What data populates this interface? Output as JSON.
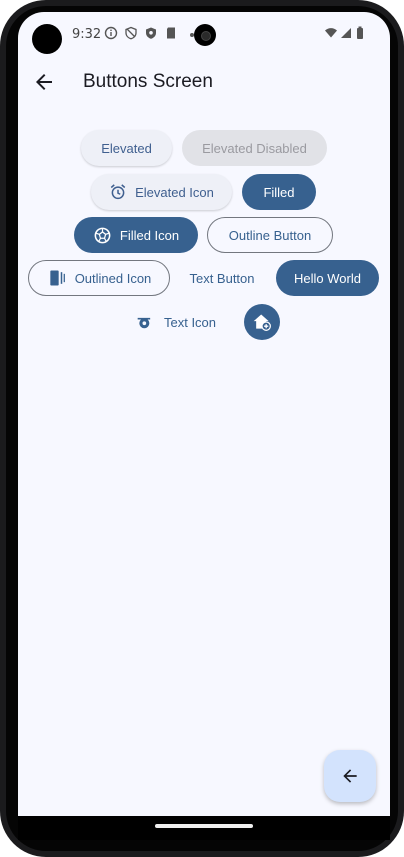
{
  "status_bar": {
    "time": "9:32"
  },
  "app_bar": {
    "title": "Buttons Screen"
  },
  "buttons": {
    "elevated": "Elevated",
    "elevated_disabled": "Elevated Disabled",
    "elevated_icon": "Elevated Icon",
    "filled": "Filled",
    "filled_icon": "Filled Icon",
    "outline_button": "Outline Button",
    "outlined_icon": "Outlined Icon",
    "text_button": "Text Button",
    "hello_world": "Hello World",
    "text_icon": "Text Icon"
  },
  "colors": {
    "primary": "#37618f",
    "screen_background": "#f7f8ff",
    "fab_background": "#d3e3fd"
  },
  "icons": {
    "back": "arrow-back-icon",
    "elevated_icon": "alarm-icon",
    "filled_icon": "soccer-ball-icon",
    "outlined_icon": "door-icon",
    "text_icon": "whistle-icon",
    "icon_button": "add-home-icon",
    "fab": "arrow-back-icon"
  }
}
